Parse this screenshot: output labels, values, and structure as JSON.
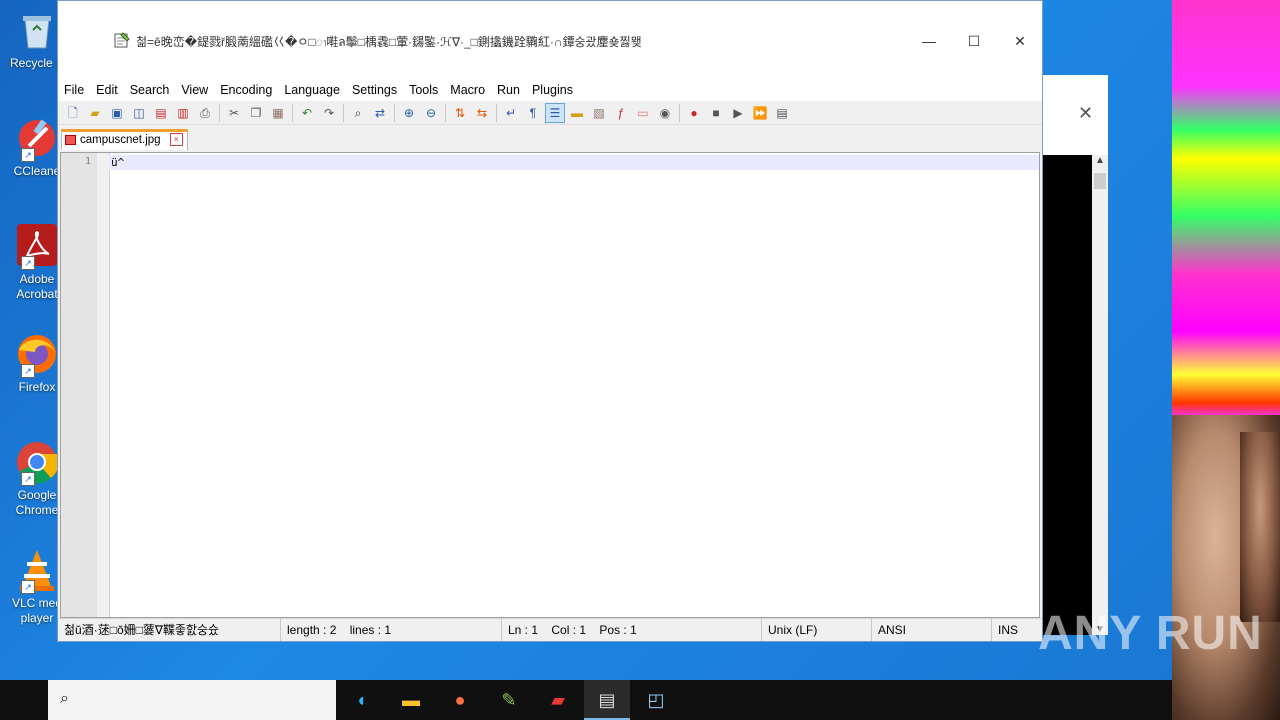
{
  "desktop": {
    "icons": [
      {
        "label": "Recycle B"
      },
      {
        "label": "CCleane"
      },
      {
        "label": "Adobe Acrobat"
      },
      {
        "label": "Firefox"
      },
      {
        "label": "Google Chrome"
      },
      {
        "label": "VLC med player"
      }
    ]
  },
  "window": {
    "title": "첢=ê晚峦�鍉戮ř腶萳縕礛巜�ㅇ□ၢ嚡ล鬡□楀毳□葷·鐋鍳·ℋ∇·_□鍘攭鐖跧驧紅·∩鐔숭괐䴤숒찛뫶",
    "min_symbol": "—",
    "max_symbol": "☐",
    "close_symbol": "✕",
    "menu": [
      "File",
      "Edit",
      "Search",
      "View",
      "Encoding",
      "Language",
      "Settings",
      "Tools",
      "Macro",
      "Run",
      "Plugins"
    ],
    "tab": {
      "label": "campuscnet.jpg",
      "close": "×"
    },
    "editor": {
      "line_number": "1",
      "line_text": "ü^"
    },
    "status": {
      "left": "첢ŭ酒·蒁□ŏ姍□蔢∇鞢좋핤숭슜",
      "length": "length : 2",
      "lines": "lines : 1",
      "ln": "Ln : 1",
      "col": "Col : 1",
      "pos": "Pos : 1",
      "eol": "Unix (LF)",
      "encoding": "ANSI",
      "mode": "INS"
    }
  },
  "watermark": "ANY RUN"
}
